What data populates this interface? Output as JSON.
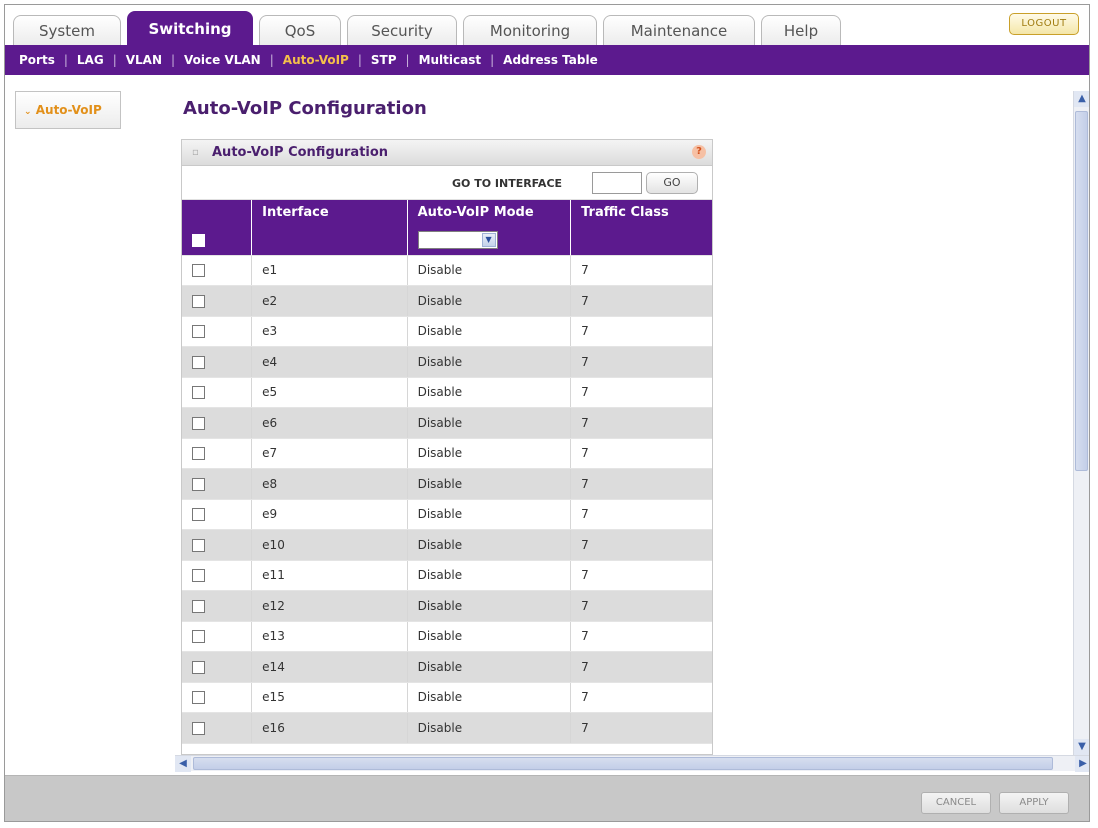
{
  "tabs": [
    {
      "label": "System"
    },
    {
      "label": "Switching"
    },
    {
      "label": "QoS"
    },
    {
      "label": "Security"
    },
    {
      "label": "Monitoring"
    },
    {
      "label": "Maintenance"
    },
    {
      "label": "Help"
    }
  ],
  "logout_label": "LOGOUT",
  "subnav": [
    "Ports",
    "LAG",
    "VLAN",
    "Voice VLAN",
    "Auto-VoIP",
    "STP",
    "Multicast",
    "Address Table"
  ],
  "sidebar": {
    "item_label": "Auto-VoIP"
  },
  "page_title": "Auto-VoIP Configuration",
  "panel": {
    "title": "Auto-VoIP Configuration",
    "goto_label": "GO TO INTERFACE",
    "goto_value": "",
    "go_button": "GO",
    "headers": [
      "",
      "Interface",
      "Auto-VoIP Mode",
      "Traffic Class"
    ],
    "rows": [
      {
        "interface": "e1",
        "mode": "Disable",
        "traffic_class": "7"
      },
      {
        "interface": "e2",
        "mode": "Disable",
        "traffic_class": "7"
      },
      {
        "interface": "e3",
        "mode": "Disable",
        "traffic_class": "7"
      },
      {
        "interface": "e4",
        "mode": "Disable",
        "traffic_class": "7"
      },
      {
        "interface": "e5",
        "mode": "Disable",
        "traffic_class": "7"
      },
      {
        "interface": "e6",
        "mode": "Disable",
        "traffic_class": "7"
      },
      {
        "interface": "e7",
        "mode": "Disable",
        "traffic_class": "7"
      },
      {
        "interface": "e8",
        "mode": "Disable",
        "traffic_class": "7"
      },
      {
        "interface": "e9",
        "mode": "Disable",
        "traffic_class": "7"
      },
      {
        "interface": "e10",
        "mode": "Disable",
        "traffic_class": "7"
      },
      {
        "interface": "e11",
        "mode": "Disable",
        "traffic_class": "7"
      },
      {
        "interface": "e12",
        "mode": "Disable",
        "traffic_class": "7"
      },
      {
        "interface": "e13",
        "mode": "Disable",
        "traffic_class": "7"
      },
      {
        "interface": "e14",
        "mode": "Disable",
        "traffic_class": "7"
      },
      {
        "interface": "e15",
        "mode": "Disable",
        "traffic_class": "7"
      },
      {
        "interface": "e16",
        "mode": "Disable",
        "traffic_class": "7"
      }
    ]
  },
  "footer": {
    "cancel_label": "CANCEL",
    "apply_label": "APPLY"
  },
  "colors": {
    "brand_purple": "#5c1a8e",
    "accent_orange": "#e2901a",
    "active_subnav": "#f4c04a"
  }
}
